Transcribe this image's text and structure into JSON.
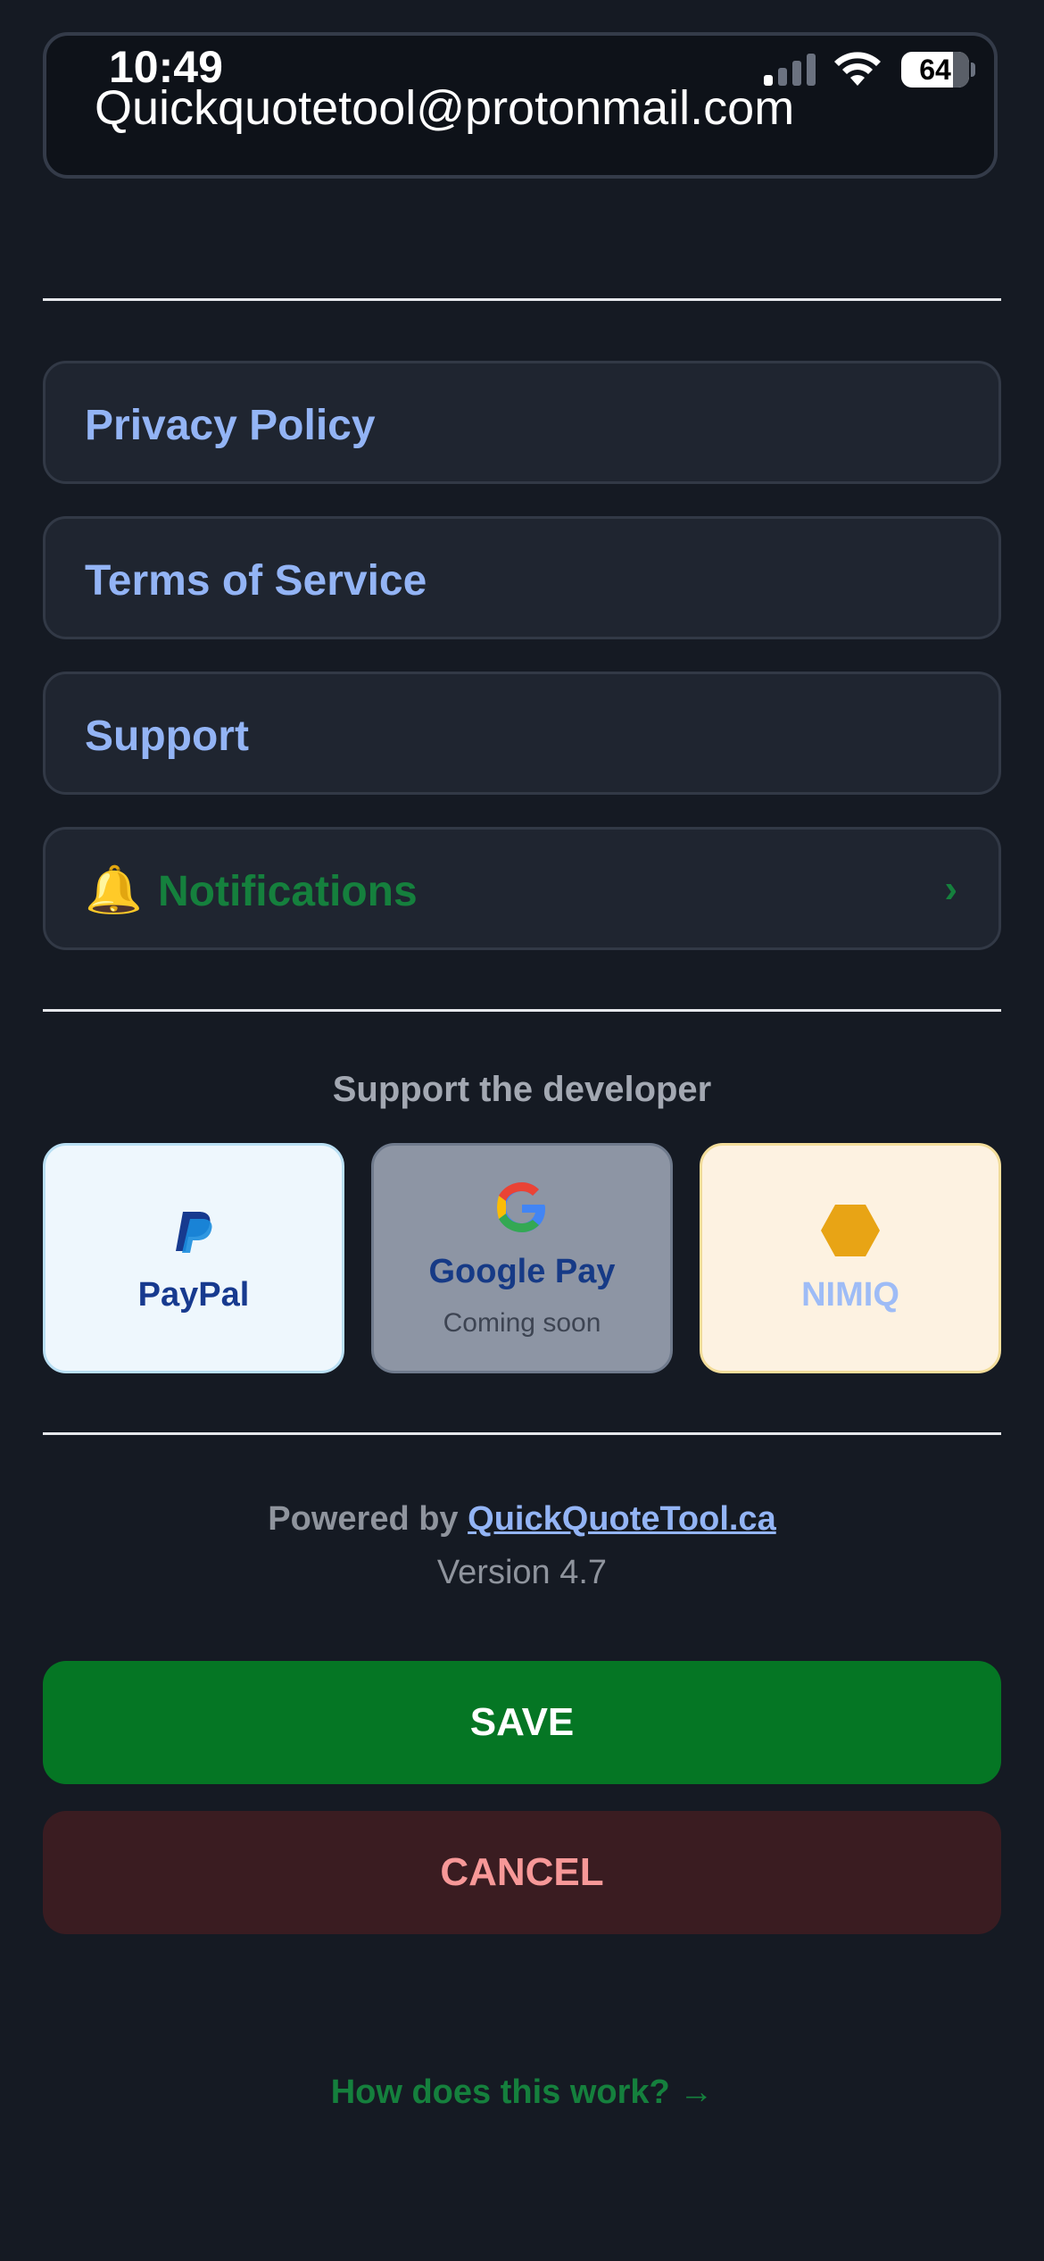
{
  "status_bar": {
    "time": "10:49",
    "battery": "64"
  },
  "email_field": {
    "value": "Quickquotetool@protonmail.com"
  },
  "links": {
    "privacy": "Privacy Policy",
    "terms": "Terms of Service",
    "support": "Support",
    "notifications": "Notifications",
    "notifications_icon": "bell-icon",
    "chevron": "›"
  },
  "support_section": {
    "heading": "Support the developer",
    "paypal": {
      "label": "PayPal",
      "icon": "paypal-icon"
    },
    "gpay": {
      "label": "Google Pay",
      "sublabel": "Coming soon",
      "icon": "google-icon"
    },
    "nimiq": {
      "label": "NIMIQ",
      "icon": "nimiq-hexagon-icon"
    }
  },
  "footer": {
    "powered_prefix": "Powered by",
    "powered_link": "QuickQuoteTool.ca",
    "version": "Version 4.7"
  },
  "actions": {
    "save": "SAVE",
    "cancel": "CANCEL",
    "how_link": "How does this work? →"
  },
  "colors": {
    "background": "#151a23",
    "link_blue": "#93b4f5",
    "accent_green": "#15803d",
    "save_green": "#057624",
    "cancel_bg": "#3a1c21",
    "cancel_text": "#f79898"
  }
}
